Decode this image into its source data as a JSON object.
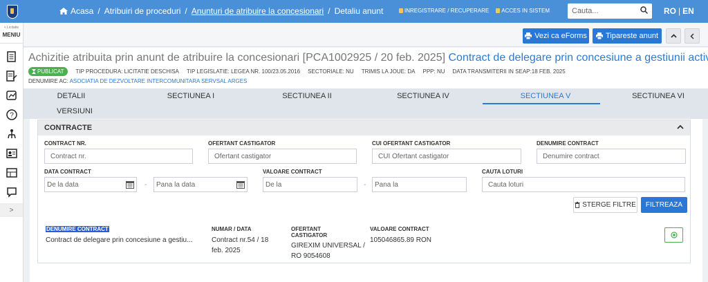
{
  "topbar": {
    "breadcrumb": [
      {
        "label": "Acasa",
        "underline": false
      },
      {
        "label": "Atribuiri de proceduri",
        "underline": false
      },
      {
        "label": "Anunturi de atribuire la concesionari",
        "underline": true
      },
      {
        "label": "Detaliu anunt",
        "underline": false
      }
    ],
    "register_link": "INREGISTRARE / RECUPERARE",
    "login_link": "ACCES IN SISTEM",
    "search_placeholder": "Cauta...",
    "lang_ro": "RO",
    "lang_sep": "|",
    "lang_en": "EN"
  },
  "sidebar": {
    "small_label": "< Licitatie",
    "menu_label": "MENIU",
    "icons": [
      "document-icon",
      "edit-list-icon",
      "chart-icon",
      "help-icon",
      "tree-icon",
      "id-card-icon",
      "dashboard-icon",
      "chat-icon"
    ],
    "expand": ">"
  },
  "actions": {
    "eforms_label": "Vezi ca eForms",
    "print_label": "Tipareste anunt"
  },
  "notice": {
    "title_prefix": "Achizitie atribuita prin anunt de atribuire la concesionari [PCA1002925 / 20 feb. 2025]",
    "title_link": "Contract de delegare prin concesiune a gestiunii activitâţilor de ...",
    "status": "PUBLICAT",
    "meta": [
      "TIP PROCEDURA: LICITATIE DESCHISA",
      "TIP LEGISLATIE: LEGEA NR. 100/23.05.2016",
      "SECTORIALE: NU",
      "TRIMIS LA JOUE: DA",
      "PPP: NU",
      "DATA TRANSMITERII IN SEAP:18 FEB. 2025"
    ],
    "ac_label": "DENUMIRE AC:",
    "ac_value": "ASOCIATIA DE DEZVOLTARE INTERCOMUNITARA SERVSAL ARGES"
  },
  "tabs": {
    "detalii": "DETALII",
    "s1": "SECTIUNEA I",
    "s2": "SECTIUNEA II",
    "s4": "SECTIUNEA IV",
    "s5": "SECTIUNEA V",
    "s6": "SECTIUNEA VI",
    "versiuni": "VERSIUNI"
  },
  "contracte": {
    "heading": "CONTRACTE",
    "f_contract_nr": {
      "label": "CONTRACT NR.",
      "placeholder": "Contract nr."
    },
    "f_ofertant": {
      "label": "OFERTANT CASTIGATOR",
      "placeholder": "Ofertant castigator"
    },
    "f_cui": {
      "label": "CUI OFERTANT CASTIGATOR",
      "placeholder": "CUI Ofertant castigator"
    },
    "f_denumire": {
      "label": "DENUMIRE CONTRACT",
      "placeholder": "Denumire contract"
    },
    "f_data": {
      "label": "DATA CONTRACT",
      "from": "De la data",
      "to": "Pana la data"
    },
    "f_valoare": {
      "label": "VALOARE CONTRACT",
      "from": "De la",
      "to": "Pana la"
    },
    "f_loturi": {
      "label": "CAUTA LOTURI",
      "placeholder": "Cauta loturi"
    },
    "dash": "-",
    "clear_label": "STERGE FILTRE",
    "filter_label": "FILTREAZA",
    "result": {
      "h_denumire": "DENUMIRE CONTRACT",
      "h_numar": "NUMAR / DATA",
      "h_ofertant_1": "OFERTANT",
      "h_ofertant_2": "CASTIGATOR",
      "h_valoare": "VALOARE CONTRACT",
      "denumire": "Contract de delegare prin concesiune a gestiu...",
      "numar_1": "Contract nr.54 / 18",
      "numar_2": "feb. 2025",
      "ofertant_1": "GIREXIM UNIVERSAL /",
      "ofertant_2": "RO 9054608",
      "valoare": "105046865.89 RON"
    }
  }
}
